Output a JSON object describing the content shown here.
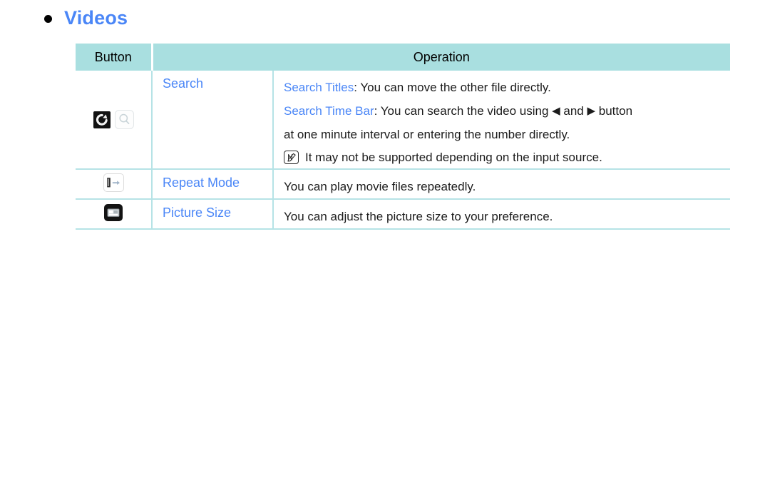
{
  "heading": {
    "bullet_icon": "bullet-dot-icon",
    "title": "Videos"
  },
  "table": {
    "headers": {
      "button": "Button",
      "operation": "Operation"
    },
    "rows": [
      {
        "icons": [
          "rotate-dark-icon",
          "search-magnifier-icon"
        ],
        "label": "Search",
        "lines": [
          {
            "keyword": "Search Titles",
            "separator": ": ",
            "text": "You can move the other file directly."
          },
          {
            "keyword": "Search Time Bar",
            "separator": ": ",
            "text_before": "You can search the video using ",
            "left_arrow": "◀",
            "text_middle": " and ",
            "right_arrow": "▶",
            "text_after": " button"
          },
          {
            "keyword": "",
            "separator": "",
            "text": "at one minute interval or entering the number directly."
          }
        ],
        "note": {
          "icon": "note-pencil-icon",
          "text": "It may not be supported depending on the input source."
        }
      },
      {
        "icons": [
          "repeat-one-icon"
        ],
        "label": "Repeat Mode",
        "lines": [
          {
            "keyword": "",
            "separator": "",
            "text": "You can play movie files repeatedly."
          }
        ]
      },
      {
        "icons": [
          "picture-size-icon"
        ],
        "label": "Picture Size",
        "lines": [
          {
            "keyword": "",
            "separator": "",
            "text": "You can adjust the picture size to your preference."
          }
        ]
      }
    ]
  },
  "colors": {
    "header_bg": "#a9dfe0",
    "border": "#b6e3e6",
    "accent_blue": "#4a86f7",
    "text": "#1b1b1b"
  }
}
